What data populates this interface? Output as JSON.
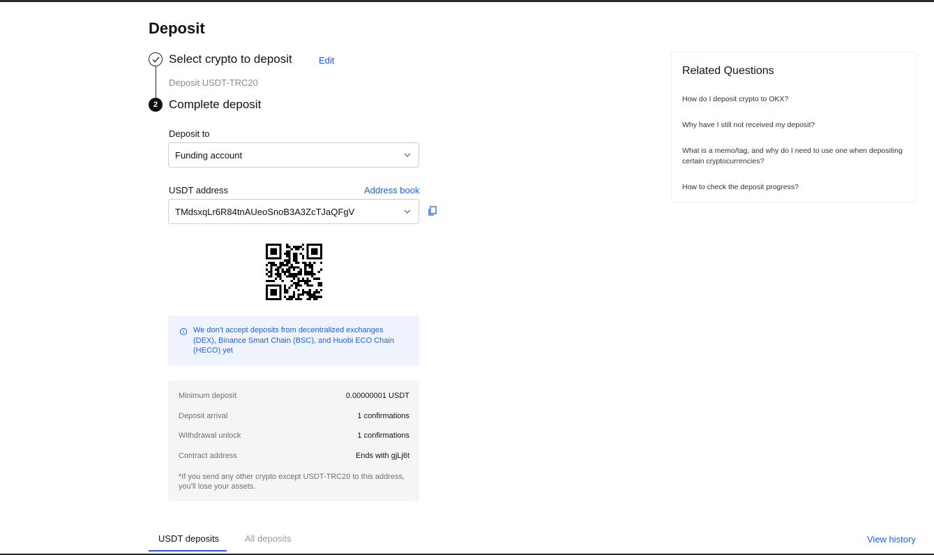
{
  "page": {
    "title": "Deposit"
  },
  "steps": {
    "step1": {
      "title": "Select crypto to deposit",
      "edit": "Edit",
      "subtitle": "Deposit USDT-TRC20"
    },
    "step2": {
      "number": "2",
      "title": "Complete deposit"
    }
  },
  "deposit_to": {
    "label": "Deposit to",
    "value": "Funding account"
  },
  "address": {
    "label": "USDT address",
    "address_book": "Address book",
    "value": "TMdsxqLr6R84tnAUeoSnoB3A3ZcTJaQFgV"
  },
  "notice": {
    "text": "We don’t accept deposits from decentralized exchanges (DEX), Binance Smart Chain (BSC), and Huobi ECO Chain (HECO) yet"
  },
  "details": {
    "rows": [
      {
        "label": "Minimum deposit",
        "value": "0.00000001 USDT"
      },
      {
        "label": "Deposit arrival",
        "value": "1 confirmations"
      },
      {
        "label": "Withdrawal unlock",
        "value": "1 confirmations"
      },
      {
        "label": "Contract address",
        "value": "Ends with gjLj6t"
      }
    ],
    "warning": "*If you send any other crypto except USDT-TRC20 to this address, you'll lose your assets."
  },
  "tabs": {
    "active": "USDT deposits",
    "inactive": "All deposits",
    "view_history": "View history"
  },
  "related": {
    "title": "Related Questions",
    "questions": [
      "How do I deposit crypto to OKX?",
      "Why have I still not received my deposit?",
      "What is a memo/tag, and why do I need to use one when depositing certain cryptocurrencies?",
      "How to check the deposit progress?"
    ]
  },
  "colors": {
    "accent": "#1f5fe0",
    "notice_bg": "#eef3fd",
    "details_bg": "#f5f5f5"
  }
}
